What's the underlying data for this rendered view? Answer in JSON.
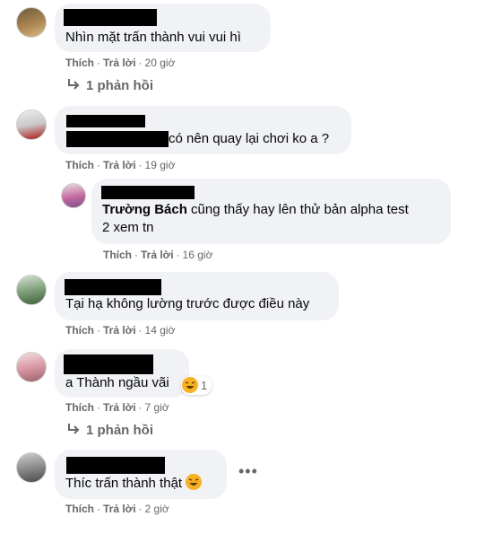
{
  "comments": [
    {
      "text": "Nhìn mặt trấn thành vui vui hì",
      "like": "Thích",
      "reply": "Trả lời",
      "time": "20 giờ",
      "replies": "1 phản hồi"
    },
    {
      "text": "có nên quay lại chơi ko a ?",
      "like": "Thích",
      "reply": "Trả lời",
      "time": "19 giờ",
      "subreply": {
        "author": "Trường Bách",
        "text_line1": " cũng thấy hay lên thử bản alpha test",
        "text_line2": "2 xem tn",
        "like": "Thích",
        "reply": "Trả lời",
        "time": "16 giờ"
      }
    },
    {
      "text": "Tại hạ không lường trước được điều này",
      "like": "Thích",
      "reply": "Trả lời",
      "time": "14 giờ"
    },
    {
      "text": "a Thành ngầu vãi",
      "reaction_count": "1",
      "like": "Thích",
      "reply": "Trả lời",
      "time": "7 giờ",
      "replies": "1 phản hồi"
    },
    {
      "text": "Thíc trấn thành thật",
      "like": "Thích",
      "reply": "Trả lời",
      "time": "2 giờ"
    }
  ],
  "colors": {
    "bubble": "#f0f2f5",
    "meta": "#65676b",
    "emoji": "#f7b125"
  },
  "icons": {
    "reply_arrow": "reply-arrow-icon",
    "reaction": "laughing-emoji-icon",
    "more": "more-horizontal-icon"
  }
}
